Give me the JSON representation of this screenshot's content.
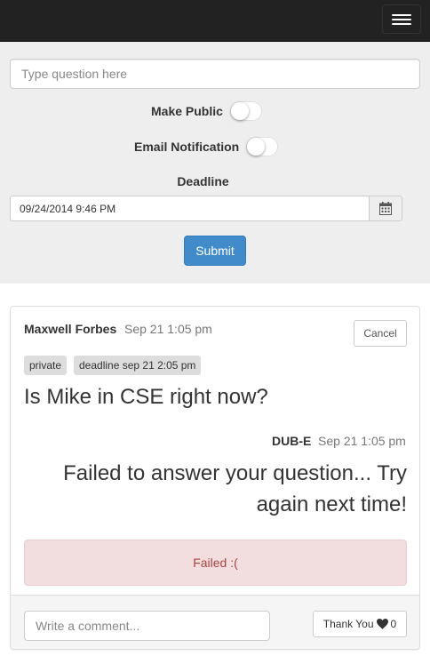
{
  "form": {
    "question_placeholder": "Type question here",
    "make_public_label": "Make Public",
    "email_notification_label": "Email Notification",
    "make_public_on": false,
    "email_notification_on": false,
    "deadline_label": "Deadline",
    "deadline_value": "09/24/2014 9:46 PM",
    "submit_label": "Submit"
  },
  "post": {
    "author": "Maxwell Forbes",
    "time": "Sep 21 1:05 pm",
    "cancel_label": "Cancel",
    "tags": [
      "private",
      "deadline sep 21 2:05 pm"
    ],
    "question": "Is Mike in CSE right now?",
    "answer_author": "DUB-E",
    "answer_time": "Sep 21 1:05 pm",
    "answer": "Failed to answer your question... Try again next time!",
    "status": "Failed :(",
    "comment_placeholder": "Write a comment...",
    "thanks_label": "Thank You",
    "thanks_count": "0"
  },
  "icons": {
    "menu": "hamburger-icon",
    "calendar": "calendar-icon",
    "heart": "heart-icon"
  },
  "colors": {
    "navbar": "#222222",
    "form_bg": "#eeeeee",
    "primary": "#428bca",
    "alert_bg": "#f2dede",
    "alert_text": "#a94442"
  }
}
